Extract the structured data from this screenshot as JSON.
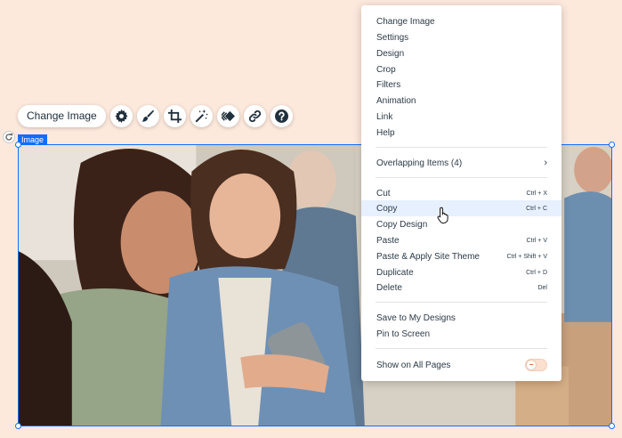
{
  "toolbar": {
    "change_image_label": "Change Image",
    "icons": [
      "gear-icon",
      "brush-icon",
      "crop-icon",
      "magic-wand-icon",
      "animation-icon",
      "link-icon",
      "help-icon"
    ]
  },
  "selection": {
    "tag_label": "Image",
    "accent": "#116dff"
  },
  "context_menu": {
    "group1": [
      "Change Image",
      "Settings",
      "Design",
      "Crop",
      "Filters",
      "Animation",
      "Link",
      "Help"
    ],
    "overlapping": "Overlapping Items (4)",
    "group2": [
      {
        "label": "Cut",
        "shortcut": "Ctrl + X"
      },
      {
        "label": "Copy",
        "shortcut": "Ctrl + C"
      },
      {
        "label": "Copy Design",
        "shortcut": ""
      },
      {
        "label": "Paste",
        "shortcut": "Ctrl + V"
      },
      {
        "label": "Paste & Apply Site Theme",
        "shortcut": "Ctrl + Shift + V"
      },
      {
        "label": "Duplicate",
        "shortcut": "Ctrl + D"
      },
      {
        "label": "Delete",
        "shortcut": "Del"
      }
    ],
    "group3": [
      "Save to My Designs",
      "Pin to Screen"
    ],
    "show_on_all_pages": "Show on All Pages",
    "show_on_all_pages_enabled": false,
    "hovered_item": "Copy"
  },
  "colors": {
    "canvas_bg": "#fde9dc",
    "menu_hover": "#e7f0ff"
  }
}
